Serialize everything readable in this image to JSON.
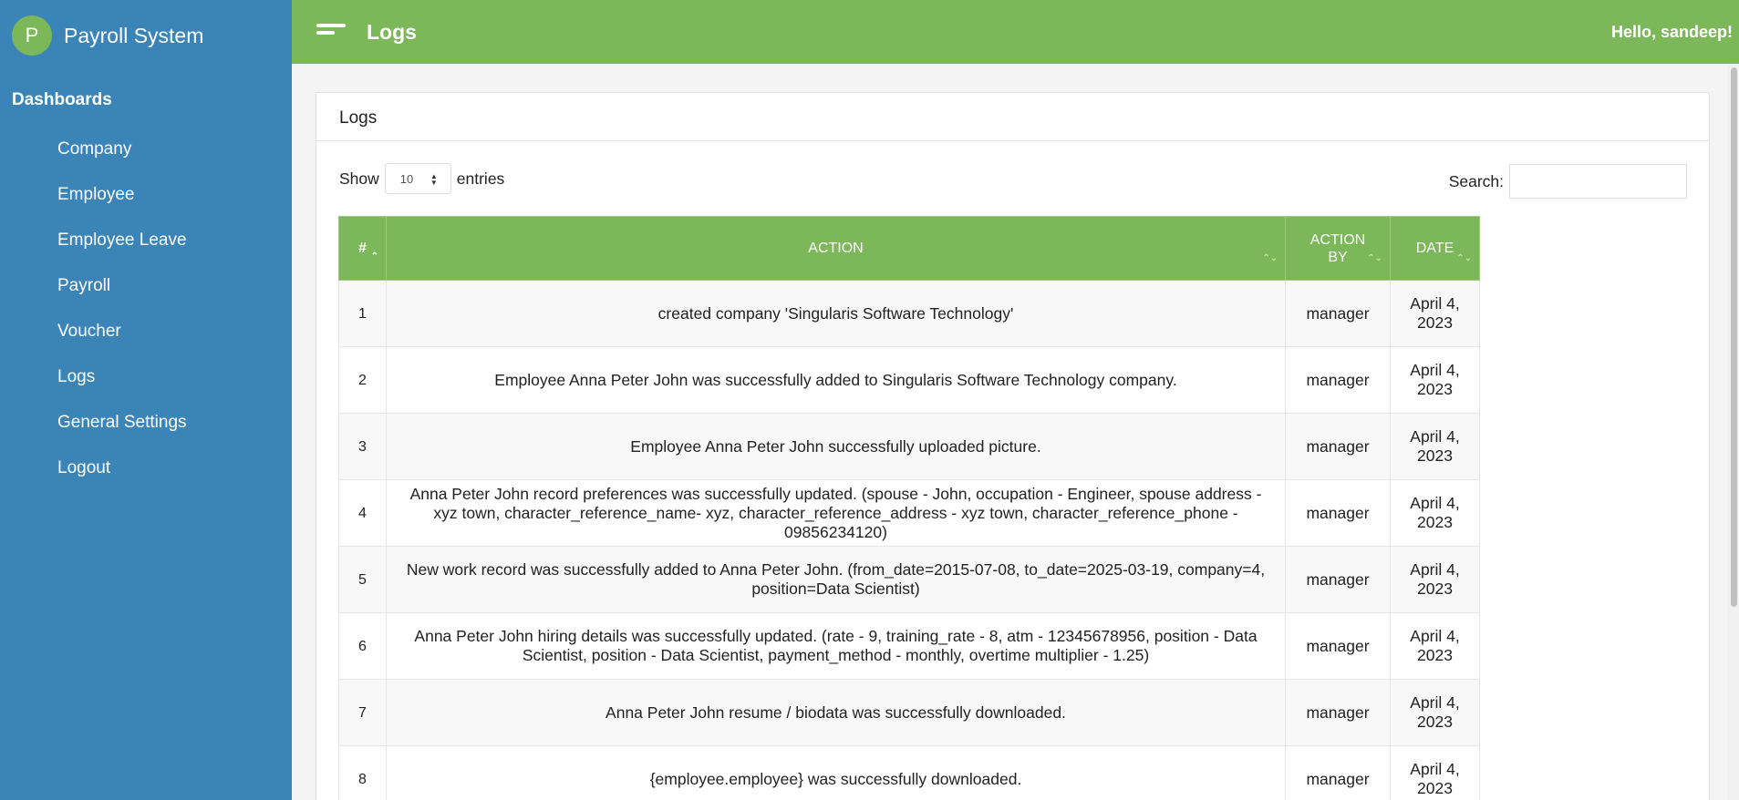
{
  "sidebar": {
    "brand_initial": "P",
    "brand_name": "Payroll System",
    "heading": "Dashboards",
    "items": [
      {
        "label": "Company"
      },
      {
        "label": "Employee"
      },
      {
        "label": "Employee Leave"
      },
      {
        "label": "Payroll"
      },
      {
        "label": "Voucher"
      },
      {
        "label": "Logs"
      },
      {
        "label": "General Settings"
      },
      {
        "label": "Logout"
      }
    ]
  },
  "topbar": {
    "title": "Logs",
    "greeting": "Hello, sandeep!"
  },
  "card": {
    "title": "Logs",
    "show_label": "Show",
    "entries_value": "10",
    "entries_label": "entries",
    "search_label": "Search:",
    "search_value": ""
  },
  "table": {
    "headers": {
      "num": "#",
      "action": "ACTION",
      "action_by_line1": "ACTION",
      "action_by_line2": "BY",
      "date": "DATE"
    },
    "rows": [
      {
        "num": "1",
        "action": "created company 'Singularis Software Technology'",
        "by": "manager",
        "date": "April 4, 2023"
      },
      {
        "num": "2",
        "action": "Employee Anna Peter John was successfully added to Singularis Software Technology company.",
        "by": "manager",
        "date": "April 4, 2023"
      },
      {
        "num": "3",
        "action": "Employee Anna Peter John successfully uploaded picture.",
        "by": "manager",
        "date": "April 4, 2023"
      },
      {
        "num": "4",
        "action": "Anna Peter John record preferences was successfully updated. (spouse - John, occupation - Engineer, spouse address - xyz town, character_reference_name- xyz, character_reference_address - xyz town, character_reference_phone - 09856234120)",
        "by": "manager",
        "date": "April 4, 2023"
      },
      {
        "num": "5",
        "action": "New work record was successfully added to Anna Peter John. (from_date=2015-07-08, to_date=2025-03-19, company=4, position=Data Scientist)",
        "by": "manager",
        "date": "April 4, 2023"
      },
      {
        "num": "6",
        "action": "Anna Peter John hiring details was successfully updated. (rate - 9, training_rate - 8, atm - 12345678956, position - Data Scientist, position - Data Scientist, payment_method - monthly, overtime multiplier - 1.25)",
        "by": "manager",
        "date": "April 4, 2023"
      },
      {
        "num": "7",
        "action": "Anna Peter John resume / biodata was successfully downloaded.",
        "by": "manager",
        "date": "April 4, 2023"
      },
      {
        "num": "8",
        "action": "{employee.employee} was successfully downloaded.",
        "by": "manager",
        "date": "April 4, 2023"
      }
    ]
  },
  "colors": {
    "sidebar": "#3a84b8",
    "accent_green": "#7cb85a"
  }
}
